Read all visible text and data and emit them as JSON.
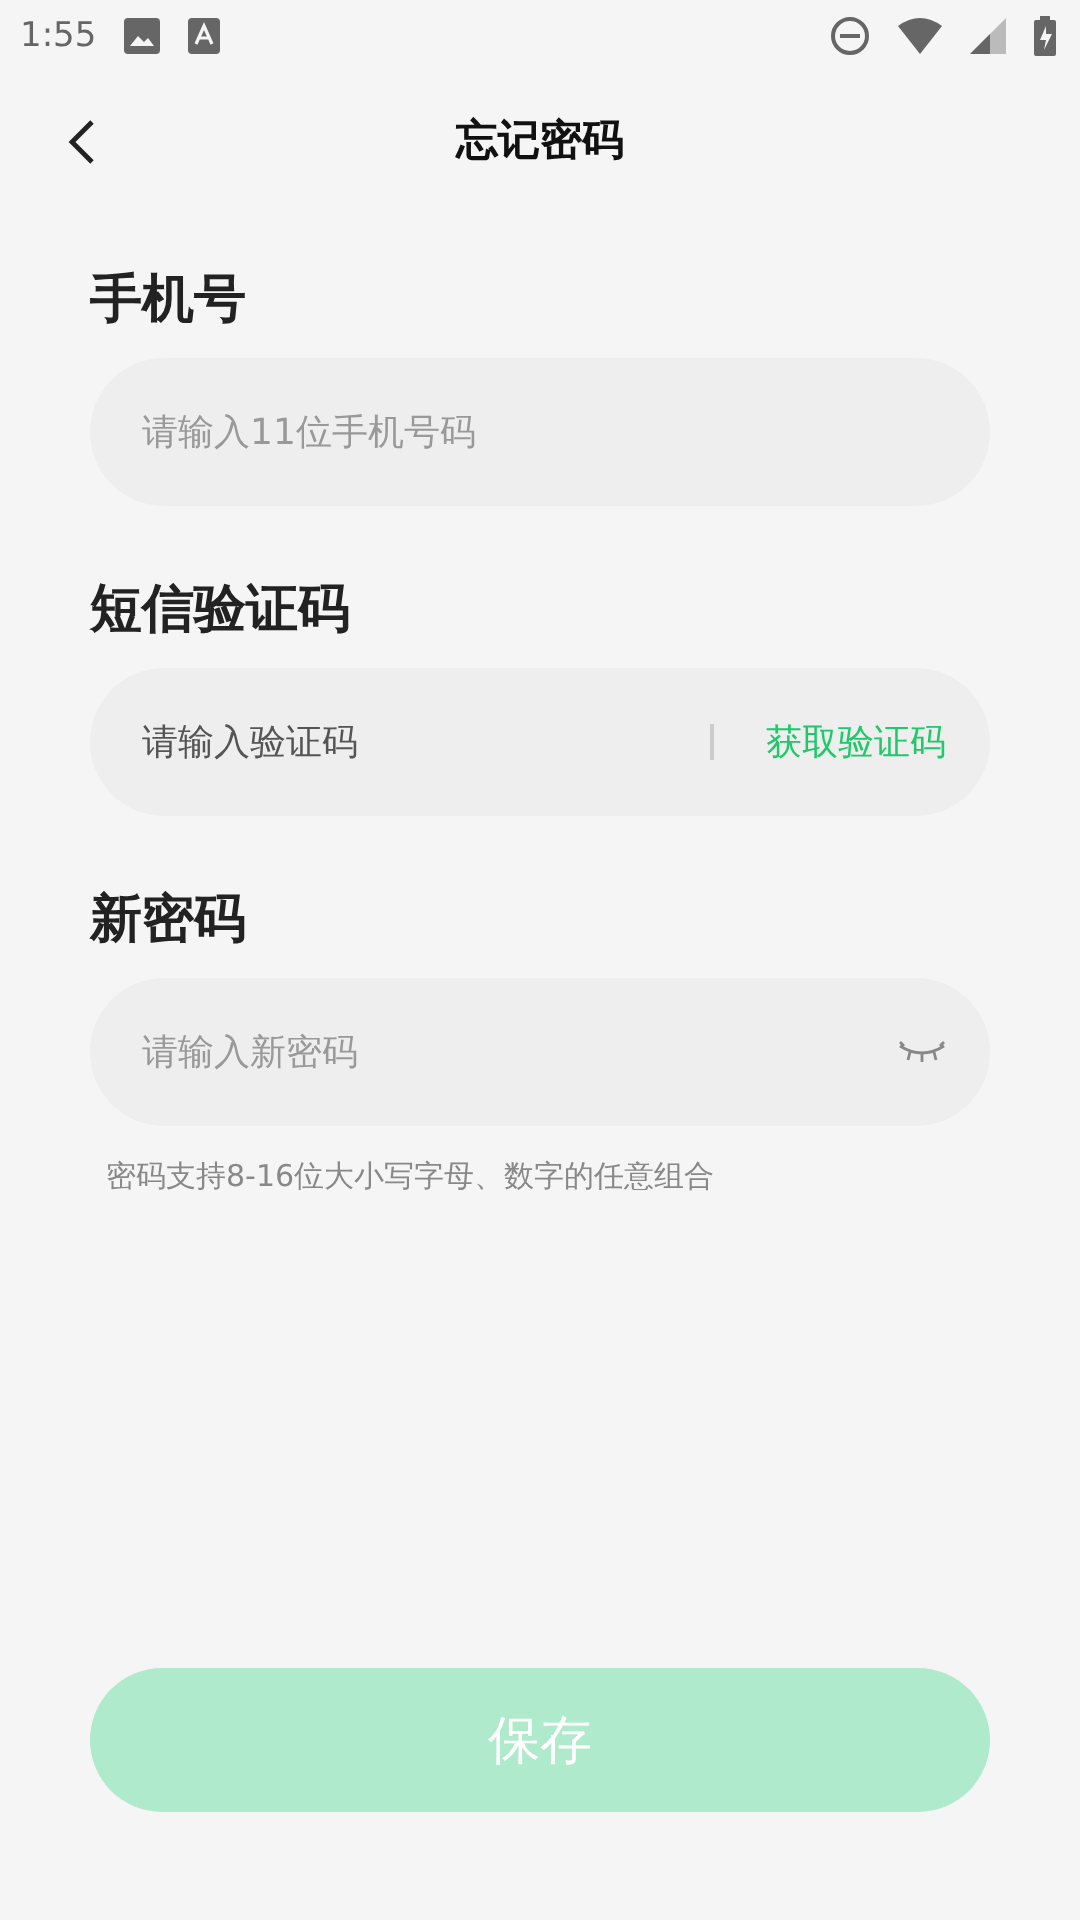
{
  "status_bar": {
    "time": "1:55"
  },
  "header": {
    "title": "忘记密码"
  },
  "fields": [
    {
      "kind": "phone",
      "label": "手机号",
      "placeholder": "请输入11位手机号码"
    },
    {
      "kind": "code",
      "label": "短信验证码",
      "placeholder": "请输入验证码",
      "action": "获取验证码"
    },
    {
      "kind": "password",
      "label": "新密码",
      "placeholder": "请输入新密码",
      "hint": "密码支持8-16位大小写字母、数字的任意组合"
    }
  ],
  "save_button": {
    "label": "保存",
    "disabled": true
  }
}
